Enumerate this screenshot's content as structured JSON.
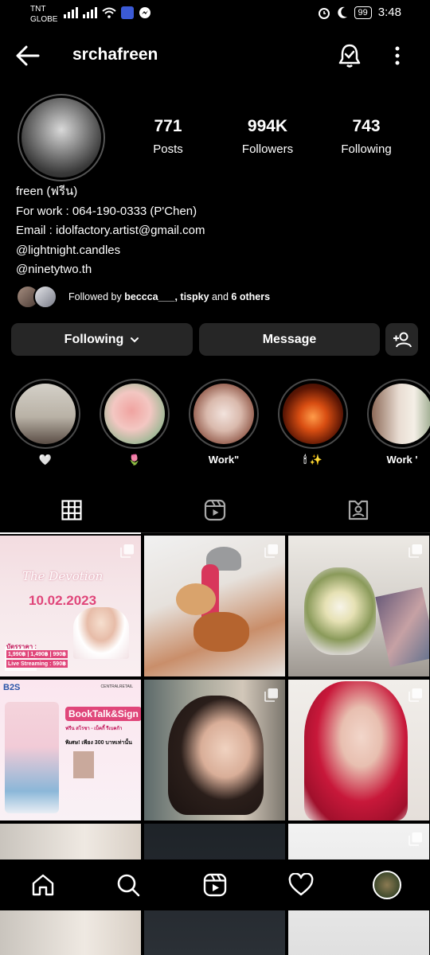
{
  "status_bar": {
    "carrier_line1": "TNT",
    "carrier_line2": "GLOBE",
    "battery": "99",
    "time": "3:48"
  },
  "header": {
    "username": "srchafreen",
    "icons": [
      "arrow-left-icon",
      "bell-check-icon",
      "more-vertical-icon"
    ]
  },
  "profile": {
    "stats": [
      {
        "value": "771",
        "label": "Posts"
      },
      {
        "value": "994K",
        "label": "Followers"
      },
      {
        "value": "743",
        "label": "Following"
      }
    ],
    "bio": [
      "freen (ฟรีน)",
      "For work : 064-190-0333 (P'Chen)",
      "Email : idolfactory.artist@gmail.com",
      "@lightnight.candles",
      "@ninetytwo.th"
    ],
    "followed_by_prefix": "Followed by",
    "followed_by_user1": "beccca___",
    "followed_by_sep": ",",
    "followed_by_user2": "tispky",
    "followed_by_and": "and",
    "followed_by_others": "6 others"
  },
  "actions": {
    "following_label": "Following",
    "message_label": "Message"
  },
  "highlights": [
    {
      "label": "🤍",
      "colors": [
        "#c8c2b8",
        "#4a3e38"
      ]
    },
    {
      "label": "🌷",
      "colors": [
        "#f2c9c4",
        "#7fa07a"
      ]
    },
    {
      "label": "Work\"",
      "colors": [
        "#e8d8d2",
        "#8a5a4e"
      ]
    },
    {
      "label": "🕯 ✨",
      "colors": [
        "#e66a2a",
        "#2a0d04"
      ]
    },
    {
      "label": "Work '",
      "colors": [
        "#e8dcd2",
        "#6f5a4d"
      ]
    }
  ],
  "tabs": [
    "grid-icon",
    "reels-icon",
    "tagged-icon"
  ],
  "grid": {
    "post1": {
      "top_text": "The Devotion",
      "date": "10.02.2023",
      "price_label": "บัตรราคา :",
      "prices": "1,990฿ | 1,490฿ | 990฿",
      "live": "Live Streaming : 590฿"
    },
    "post4": {
      "brand": "B2S",
      "title": "BookTalk&Sign",
      "subtitle": "ฟรีน สโรชา - เบ็คกี้ รีเบคก้า",
      "price_line": "พิเศษ! เพียง 300 บาทเท่านั้น",
      "store": "CENTRALRETAIL"
    }
  },
  "bottom_nav": [
    "home-icon",
    "search-icon",
    "reels-icon",
    "heart-icon",
    "profile-avatar"
  ]
}
